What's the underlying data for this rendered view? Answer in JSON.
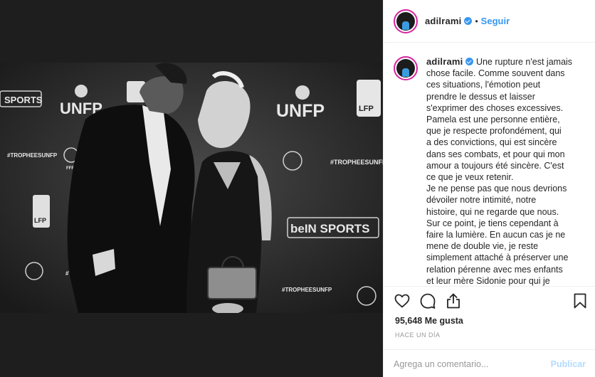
{
  "post": {
    "username": "adilrami",
    "follow_label": "Seguir",
    "separator": "•",
    "caption_lines": [
      "Une rupture n'est jamais",
      "chose facile. Comme souvent dans",
      "ces situations, l'émotion peut",
      "prendre le dessus et laisser",
      "s'exprimer des choses excessives.",
      "Pamela est une personne entière,",
      "que je respecte profondément, qui",
      "a des convictions, qui est sincère",
      "dans ses combats, et pour qui mon",
      "amour a toujours été sincère. C'est",
      "ce que je veux retenir.",
      "Je ne pense pas que nous devrions",
      "dévoiler notre intimité, notre",
      "histoire, qui ne regarde que nous.",
      "Sur ce point, je tiens cependant à",
      "faire la lumière. En aucun cas je ne",
      "mene de double vie, je reste",
      "simplement attaché à préserver une",
      "relation pérenne avec mes enfants",
      "et leur mère Sidonie pour qui je"
    ],
    "likes": "95,648 Me gusta",
    "timestamp": "HACE UN DÍA",
    "comment_placeholder": "Agrega un comentario...",
    "publish_label": "Publicar"
  },
  "photo": {
    "backdrop_logos": {
      "unfp": "UNFP",
      "lfp": "LFP",
      "sports": "SPORTS",
      "bein": "beIN SPORTS",
      "hashtag": "#TROPHEESUNFP",
      "fff": "FFF"
    }
  },
  "icons": {
    "like": "heart-icon",
    "comment": "comment-icon",
    "share": "share-icon",
    "save": "bookmark-icon"
  },
  "colors": {
    "accent": "#3897f0",
    "story_ring": "#d6249f",
    "text": "#262626",
    "muted": "#999999",
    "publish_disabled": "#b3dbff"
  }
}
